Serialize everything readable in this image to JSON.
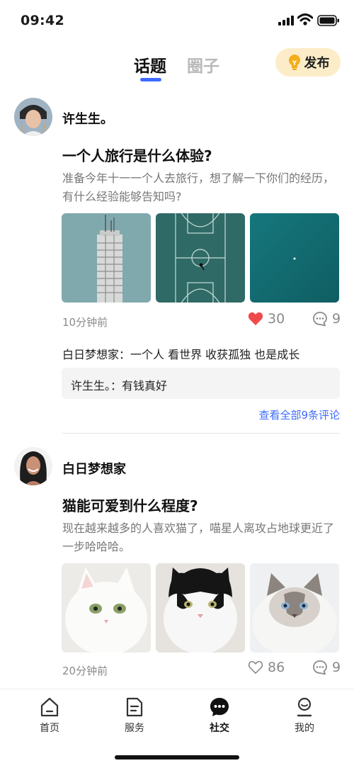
{
  "status_bar": {
    "time": "09:42"
  },
  "header": {
    "tabs": [
      {
        "label": "话题",
        "active": true
      },
      {
        "label": "圈子",
        "active": false
      }
    ],
    "publish_label": "发布",
    "accent_color": "#3d6bff",
    "publish_bg": "#fcedc8"
  },
  "posts": [
    {
      "author": "许生生。",
      "title": "一个人旅行是什么体验?",
      "description": "准备今年十一一个人去旅行，想了解一下你们的经历，有什么经验能够告知吗?",
      "images": [
        "building-photo",
        "basketball-court-aerial-photo",
        "teal-sea-aerial-photo"
      ],
      "time": "10分钟前",
      "likes": "30",
      "liked": true,
      "comment_count": "9",
      "comments": [
        {
          "text": "白日梦想家：一个人 看世界 收获孤独 也是成长"
        },
        {
          "text": "许生生。：有钱真好"
        }
      ],
      "view_all": "查看全部9条评论"
    },
    {
      "author": "白日梦想家",
      "title": "猫能可爱到什么程度?",
      "description": "现在越来越多的人喜欢猫了，喵星人离攻占地球更近了一步哈哈哈。",
      "images": [
        "white-cat-photo",
        "black-white-cat-photo",
        "fluffy-blue-eyed-cat-photo"
      ],
      "time": "20分钟前",
      "likes": "86",
      "liked": false,
      "comment_count": "9"
    }
  ],
  "bottom_nav": {
    "items": [
      {
        "label": "首页",
        "icon": "home-icon"
      },
      {
        "label": "服务",
        "icon": "service-icon"
      },
      {
        "label": "社交",
        "icon": "social-icon",
        "active": true
      },
      {
        "label": "我的",
        "icon": "profile-icon"
      }
    ]
  }
}
